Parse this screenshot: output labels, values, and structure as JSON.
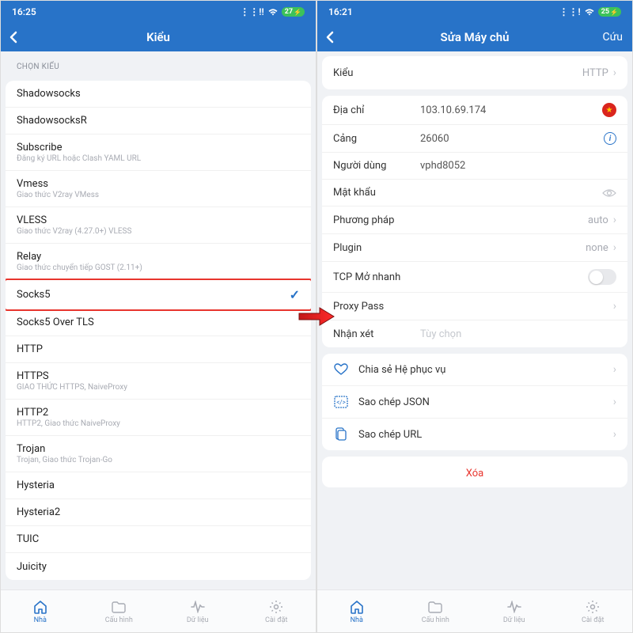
{
  "left": {
    "status": {
      "time": "16:25",
      "battery": "27"
    },
    "nav": {
      "title": "Kiểu"
    },
    "section_header": "CHỌN KIỂU",
    "types": [
      {
        "label": "Shadowsocks",
        "sub": ""
      },
      {
        "label": "ShadowsocksR",
        "sub": ""
      },
      {
        "label": "Subscribe",
        "sub": "Đăng ký URL hoặc Clash YAML URL"
      },
      {
        "label": "Vmess",
        "sub": "Giao thức V2ray VMess"
      },
      {
        "label": "VLESS",
        "sub": "Giao thức V2ray (4.27.0+) VLESS"
      },
      {
        "label": "Relay",
        "sub": "Giao thức chuyển tiếp GOST (2.11+)"
      },
      {
        "label": "Socks5",
        "sub": "",
        "selected": true,
        "highlight": true
      },
      {
        "label": "Socks5 Over TLS",
        "sub": ""
      },
      {
        "label": "HTTP",
        "sub": ""
      },
      {
        "label": "HTTPS",
        "sub": "GIAO THỨC HTTPS, NaiveProxy"
      },
      {
        "label": "HTTP2",
        "sub": "HTTP2, Giao thức NaiveProxy"
      },
      {
        "label": "Trojan",
        "sub": "Trojan, Giao thức Trojan-Go"
      },
      {
        "label": "Hysteria",
        "sub": ""
      },
      {
        "label": "Hysteria2",
        "sub": ""
      },
      {
        "label": "TUIC",
        "sub": ""
      },
      {
        "label": "Juicity",
        "sub": ""
      }
    ]
  },
  "right": {
    "status": {
      "time": "16:21",
      "battery": "25"
    },
    "nav": {
      "title": "Sửa Máy chủ",
      "action": "Cứu"
    },
    "type_row": {
      "label": "Kiểu",
      "value": "HTTP"
    },
    "details": {
      "address": {
        "label": "Địa chỉ",
        "value": "103.10.69.174"
      },
      "port": {
        "label": "Cảng",
        "value": "26060"
      },
      "user": {
        "label": "Người dùng",
        "value": "vphd8052"
      },
      "password": {
        "label": "Mật khẩu",
        "value": ""
      },
      "method": {
        "label": "Phương pháp",
        "value": "auto"
      },
      "plugin": {
        "label": "Plugin",
        "value": "none"
      },
      "tcp_fast": {
        "label": "TCP Mở nhanh"
      },
      "proxy_pass": {
        "label": "Proxy Pass"
      },
      "comment": {
        "label": "Nhận xét",
        "placeholder": "Tùy chọn"
      }
    },
    "actions": {
      "share": "Chia sẻ Hệ phục vụ",
      "json": "Sao chép JSON",
      "url": "Sao chép URL",
      "delete": "Xóa"
    }
  },
  "tabs": [
    {
      "id": "home",
      "label": "Nhà"
    },
    {
      "id": "config",
      "label": "Cấu hình"
    },
    {
      "id": "data",
      "label": "Dữ liệu"
    },
    {
      "id": "settings",
      "label": "Cài đặt"
    }
  ]
}
